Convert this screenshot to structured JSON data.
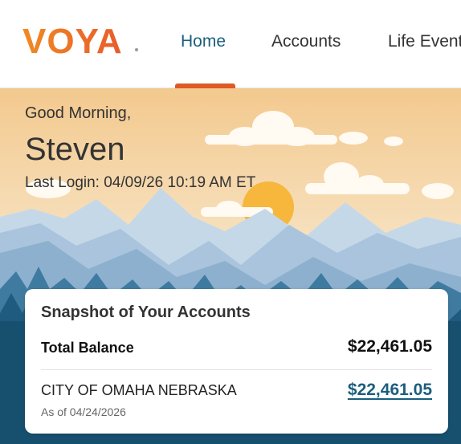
{
  "header": {
    "logo_text": "VOYA",
    "nav": [
      {
        "label": "Home",
        "active": true
      },
      {
        "label": "Accounts",
        "active": false
      },
      {
        "label": "Life Events",
        "active": false
      }
    ]
  },
  "colors": {
    "brand_orange": "#dd5a26",
    "brand_teal": "#1b5e7e"
  },
  "greeting": {
    "salutation": "Good Morning,",
    "name": "Steven",
    "last_login": "Last Login: 04/09/26 10:19 AM ET"
  },
  "snapshot": {
    "title": "Snapshot of Your Accounts",
    "total_label": "Total Balance",
    "total_value": "$22,461.05",
    "accounts": [
      {
        "name": "CITY OF OMAHA NEBRASKA",
        "value": "$22,461.05",
        "as_of": "As of 04/24/2026"
      }
    ]
  }
}
